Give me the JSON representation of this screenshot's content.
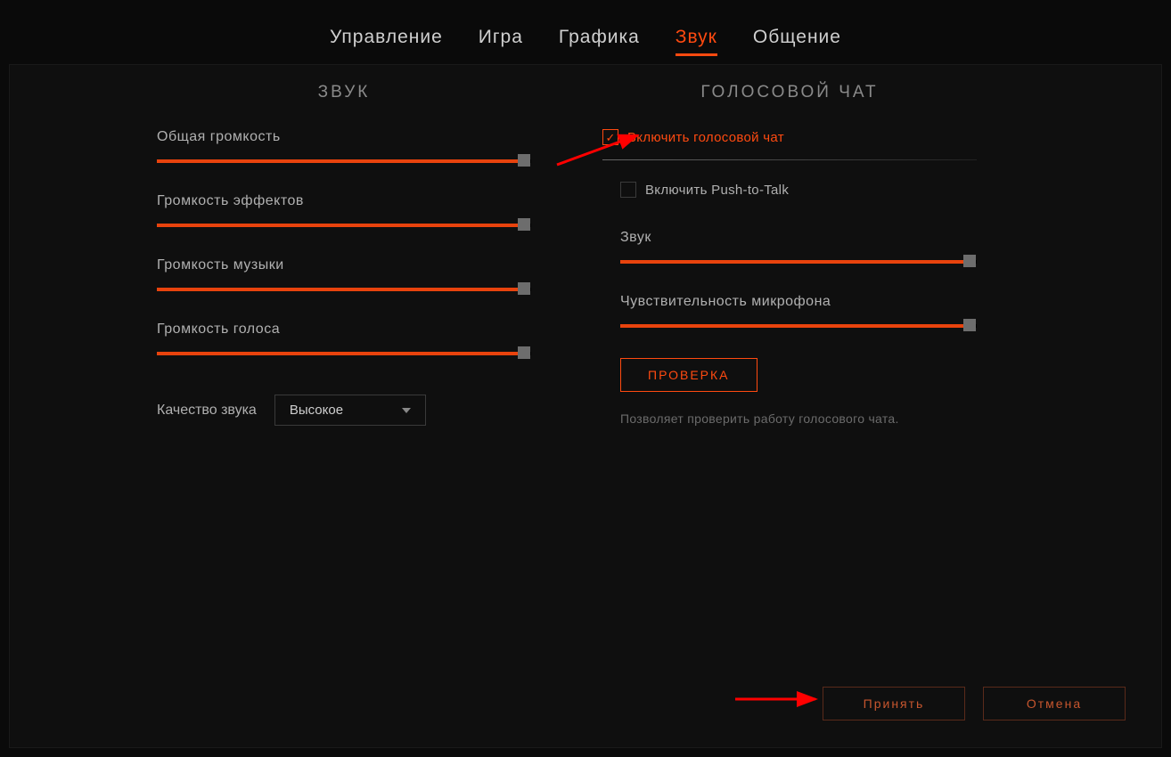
{
  "tabs": {
    "control": "Управление",
    "game": "Игра",
    "graphics": "Графика",
    "sound": "Звук",
    "communication": "Общение",
    "active": "sound"
  },
  "left": {
    "title": "ЗВУК",
    "sliders": {
      "master": {
        "label": "Общая громкость",
        "value": 98
      },
      "effects": {
        "label": "Громкость эффектов",
        "value": 98
      },
      "music": {
        "label": "Громкость музыки",
        "value": 98
      },
      "voice": {
        "label": "Громкость голоса",
        "value": 98
      }
    },
    "quality": {
      "label": "Качество звука",
      "selected": "Высокое"
    }
  },
  "right": {
    "title": "ГОЛОСОВОЙ ЧАТ",
    "enable": {
      "label": "Включить голосовой чат",
      "checked": true
    },
    "ptt": {
      "label": "Включить Push-to-Talk",
      "checked": false
    },
    "sliders": {
      "sound": {
        "label": "Звук",
        "value": 98
      },
      "mic": {
        "label": "Чувствительность микрофона",
        "value": 98
      }
    },
    "test_button": "ПРОВЕРКА",
    "hint": "Позволяет проверить работу голосового чата."
  },
  "footer": {
    "accept": "Принять",
    "cancel": "Отмена"
  },
  "colors": {
    "accent": "#e8430d"
  }
}
